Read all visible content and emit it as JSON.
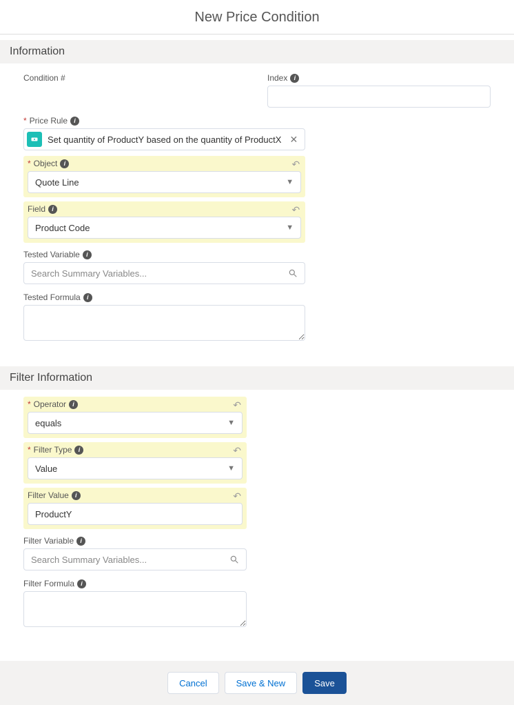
{
  "page": {
    "title": "New Price Condition"
  },
  "icons": {
    "info_glyph": "i"
  },
  "sections": {
    "information": {
      "header": "Information",
      "condition_number": {
        "label": "Condition #"
      },
      "index": {
        "label": "Index",
        "value": ""
      },
      "price_rule": {
        "label": "Price Rule",
        "selected": "Set quantity of ProductY based on the quantity of ProductX"
      },
      "object": {
        "label": "Object",
        "value": "Quote Line"
      },
      "field": {
        "label": "Field",
        "value": "Product Code"
      },
      "tested_variable": {
        "label": "Tested Variable",
        "placeholder": "Search Summary Variables..."
      },
      "tested_formula": {
        "label": "Tested Formula",
        "value": ""
      }
    },
    "filter": {
      "header": "Filter Information",
      "operator": {
        "label": "Operator",
        "value": "equals"
      },
      "filter_type": {
        "label": "Filter Type",
        "value": "Value"
      },
      "filter_value": {
        "label": "Filter Value",
        "value": "ProductY"
      },
      "filter_variable": {
        "label": "Filter Variable",
        "placeholder": "Search Summary Variables..."
      },
      "filter_formula": {
        "label": "Filter Formula",
        "value": ""
      }
    }
  },
  "footer": {
    "cancel": "Cancel",
    "save_new": "Save & New",
    "save": "Save"
  },
  "required_marker": "*"
}
